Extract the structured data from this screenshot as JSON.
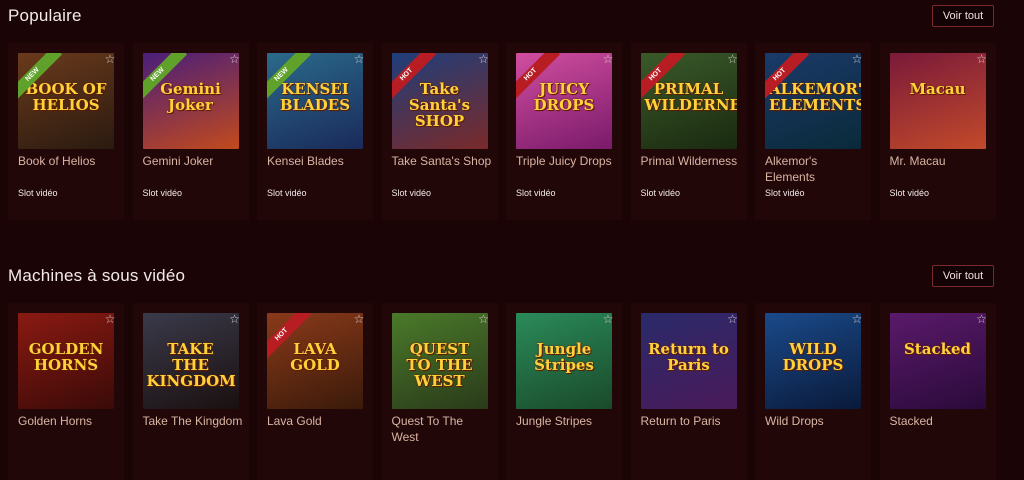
{
  "sections": [
    {
      "title": "Populaire",
      "view_all": "Voir tout",
      "games": [
        {
          "name": "Book of Helios",
          "type": "Slot vidéo",
          "badge": "NEW",
          "art": "BOOK OF HELIOS",
          "bg1": "#6a3a1c",
          "bg2": "#2a1a10"
        },
        {
          "name": "Gemini Joker",
          "type": "Slot vidéo",
          "badge": "NEW",
          "art": "Gemini Joker",
          "bg1": "#4a1e7a",
          "bg2": "#c24a1c"
        },
        {
          "name": "Kensei Blades",
          "type": "Slot vidéo",
          "badge": "NEW",
          "art": "KENSEI BLADES",
          "bg1": "#2a6a8a",
          "bg2": "#1a2a5a"
        },
        {
          "name": "Take Santa's Shop",
          "type": "Slot vidéo",
          "badge": "HOT",
          "art": "Take Santa's SHOP",
          "bg1": "#1f3e7a",
          "bg2": "#7a2a2a"
        },
        {
          "name": "Triple Juicy Drops",
          "type": "Slot vidéo",
          "badge": "HOT",
          "art": "JUICY DROPS",
          "bg1": "#d14ea0",
          "bg2": "#7a1a6a"
        },
        {
          "name": "Primal Wilderness",
          "type": "Slot vidéo",
          "badge": "HOT",
          "art": "PRIMAL WILDERNESS",
          "bg1": "#3a5a2a",
          "bg2": "#1a2a10"
        },
        {
          "name": "Alkemor's Elements",
          "type": "Slot vidéo",
          "badge": "HOT",
          "art": "ALKEMOR'S ELEMENTS",
          "bg1": "#1a3a6a",
          "bg2": "#0a2a3a"
        },
        {
          "name": "Mr. Macau",
          "type": "Slot vidéo",
          "badge": "",
          "art": "Macau",
          "bg1": "#7a1a3a",
          "bg2": "#c24a2a"
        }
      ]
    },
    {
      "title": "Machines à sous vidéo",
      "view_all": "Voir tout",
      "games": [
        {
          "name": "Golden Horns",
          "type": "",
          "badge": "",
          "art": "GOLDEN HORNS",
          "bg1": "#8a1a12",
          "bg2": "#3a0a08"
        },
        {
          "name": "Take The Kingdom",
          "type": "",
          "badge": "",
          "art": "TAKE THE KINGDOM",
          "bg1": "#3a3a4a",
          "bg2": "#1a1010"
        },
        {
          "name": "Lava Gold",
          "type": "",
          "badge": "HOT",
          "art": "LAVA GOLD",
          "bg1": "#8a3a1a",
          "bg2": "#3a1a0a"
        },
        {
          "name": "Quest To The West",
          "type": "",
          "badge": "",
          "art": "QUEST TO THE WEST",
          "bg1": "#4a7a2a",
          "bg2": "#2a3a1a"
        },
        {
          "name": "Jungle Stripes",
          "type": "",
          "badge": "",
          "art": "Jungle Stripes",
          "bg1": "#2a8a5a",
          "bg2": "#1a4a2a"
        },
        {
          "name": "Return to Paris",
          "type": "",
          "badge": "",
          "art": "Return to Paris",
          "bg1": "#2a2a6a",
          "bg2": "#4a1a5a"
        },
        {
          "name": "Wild Drops",
          "type": "",
          "badge": "",
          "art": "WILD DROPS",
          "bg1": "#1a4a8a",
          "bg2": "#0a1a3a"
        },
        {
          "name": "Stacked",
          "type": "",
          "badge": "",
          "art": "Stacked",
          "bg1": "#5a1a6a",
          "bg2": "#2a0a3a"
        }
      ]
    }
  ],
  "colors": {
    "background": "#1a0406",
    "card": "#220709",
    "new_ribbon": "#5fa12b",
    "hot_ribbon": "#b81d24",
    "game_name": "#d9b5a3"
  },
  "icons": {
    "favorite": "star-outline-icon"
  }
}
